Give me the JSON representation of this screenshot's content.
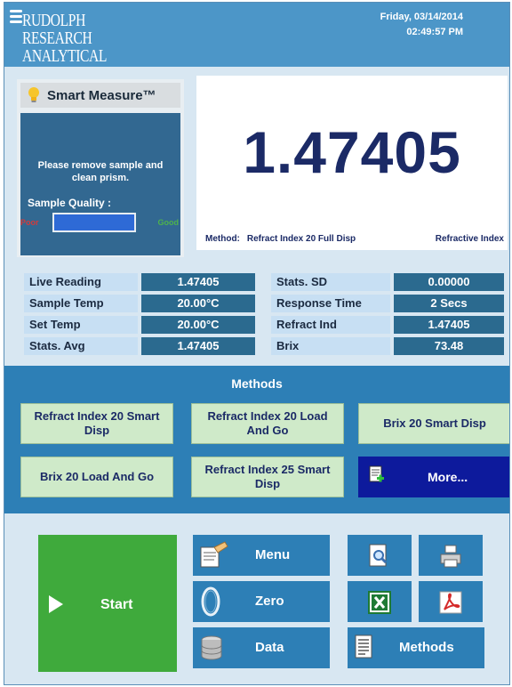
{
  "header": {
    "logo_lines": [
      "RUDOLPH",
      "RESEARCH",
      "ANALYTICAL"
    ],
    "date": "Friday, 03/14/2014",
    "time": "02:49:57 PM"
  },
  "smart_measure": {
    "title": "Smart Measure™",
    "icon": "lightbulb-icon",
    "message": "Please remove sample and clean prism.",
    "quality_label": "Sample Quality :",
    "poor_label": "Poor",
    "good_label": "Good",
    "quality_fraction": 1.0
  },
  "reading": {
    "value": "1.47405",
    "method_prefix": "Method:",
    "method_name": "Refract Index 20 Full Disp",
    "unit": "Refractive Index"
  },
  "stats": [
    {
      "label": "Live Reading",
      "value": "1.47405",
      "label2": "Stats. SD",
      "value2": "0.00000"
    },
    {
      "label": "Sample Temp",
      "value": "20.00°C",
      "label2": "Response Time",
      "value2": "2 Secs"
    },
    {
      "label": "Set Temp",
      "value": "20.00°C",
      "label2": "Refract Ind",
      "value2": "1.47405"
    },
    {
      "label": "Stats. Avg",
      "value": "1.47405",
      "label2": "Brix",
      "value2": "73.48"
    }
  ],
  "methods": {
    "title": "Methods",
    "buttons": [
      "Refract Index 20 Smart Disp",
      "Refract Index 20 Load And Go",
      "Brix 20 Smart Disp",
      "Brix 20 Load And Go",
      "Refract Index 25 Smart Disp"
    ],
    "more_label": "More..."
  },
  "bottom": {
    "start_label": "Start",
    "menu_label": "Menu",
    "zero_label": "Zero",
    "data_label": "Data",
    "methods_label": "Methods",
    "icons": [
      "preview-icon",
      "printer-icon",
      "excel-icon",
      "pdf-icon"
    ]
  },
  "colors": {
    "header_blue": "#4c96c8",
    "panel_blue": "#2d7fb6",
    "value_navy": "#1b2a66",
    "start_green": "#3faa3c",
    "method_green": "#cfeac9",
    "more_navy": "#0d1a9c"
  }
}
